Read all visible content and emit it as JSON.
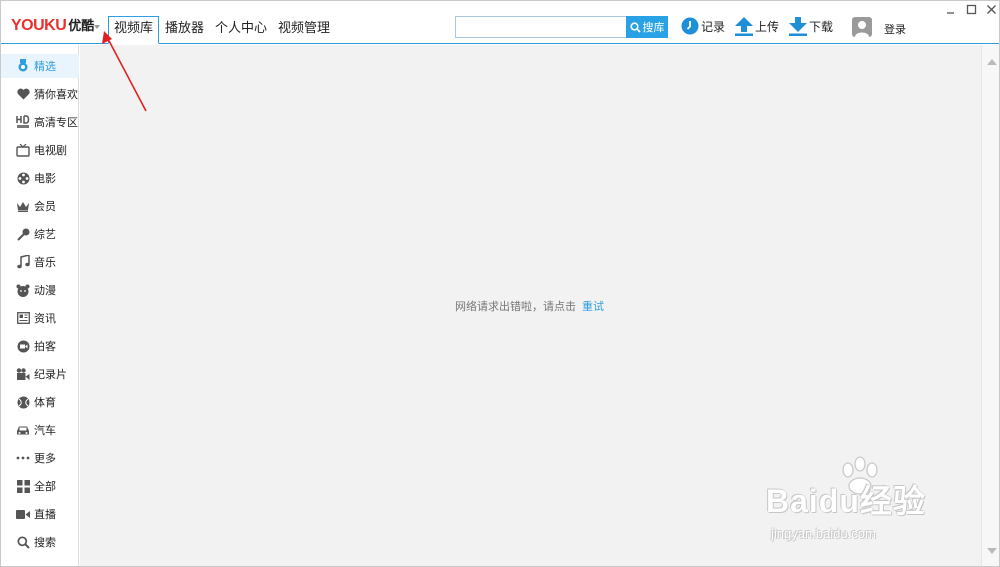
{
  "app": {
    "logo_en": "YOUKU",
    "logo_cn": "优酷",
    "accent_color": "#2d9fe0",
    "brand_color": "#e8312f"
  },
  "tabs": [
    {
      "label": "视频库",
      "active": true
    },
    {
      "label": "播放器",
      "active": false
    },
    {
      "label": "个人中心",
      "active": false
    },
    {
      "label": "视频管理",
      "active": false
    }
  ],
  "search": {
    "value": "",
    "button_label": "搜库",
    "icon": "search-icon"
  },
  "toolbar": {
    "history_label": "记录",
    "upload_label": "上传",
    "download_label": "下载",
    "login_label": "登录"
  },
  "sidebar": {
    "items": [
      {
        "label": "精选",
        "icon": "medal-icon",
        "active": true
      },
      {
        "label": "猜你喜欢",
        "icon": "heart-icon",
        "active": false
      },
      {
        "label": "高清专区",
        "icon": "hd-icon",
        "active": false
      },
      {
        "label": "电视剧",
        "icon": "tv-icon",
        "active": false
      },
      {
        "label": "电影",
        "icon": "film-reel-icon",
        "active": false
      },
      {
        "label": "会员",
        "icon": "crown-icon",
        "active": false
      },
      {
        "label": "综艺",
        "icon": "microphone-icon",
        "active": false
      },
      {
        "label": "音乐",
        "icon": "music-note-icon",
        "active": false
      },
      {
        "label": "动漫",
        "icon": "cartoon-icon",
        "active": false
      },
      {
        "label": "资讯",
        "icon": "news-icon",
        "active": false
      },
      {
        "label": "拍客",
        "icon": "camera-icon",
        "active": false
      },
      {
        "label": "纪录片",
        "icon": "video-camera-icon",
        "active": false
      },
      {
        "label": "体育",
        "icon": "ball-icon",
        "active": false
      },
      {
        "label": "汽车",
        "icon": "car-icon",
        "active": false
      },
      {
        "label": "更多",
        "icon": "more-dots-icon",
        "active": false
      },
      {
        "label": "全部",
        "icon": "grid-icon",
        "active": false
      },
      {
        "label": "直播",
        "icon": "live-icon",
        "active": false
      },
      {
        "label": "搜索",
        "icon": "search-icon",
        "active": false
      }
    ]
  },
  "main": {
    "error_text": "网络请求出错啦，请点击",
    "retry_label": "重试"
  },
  "watermark": {
    "main": "Baidu经验",
    "sub": "jingyan.baidu.com"
  }
}
